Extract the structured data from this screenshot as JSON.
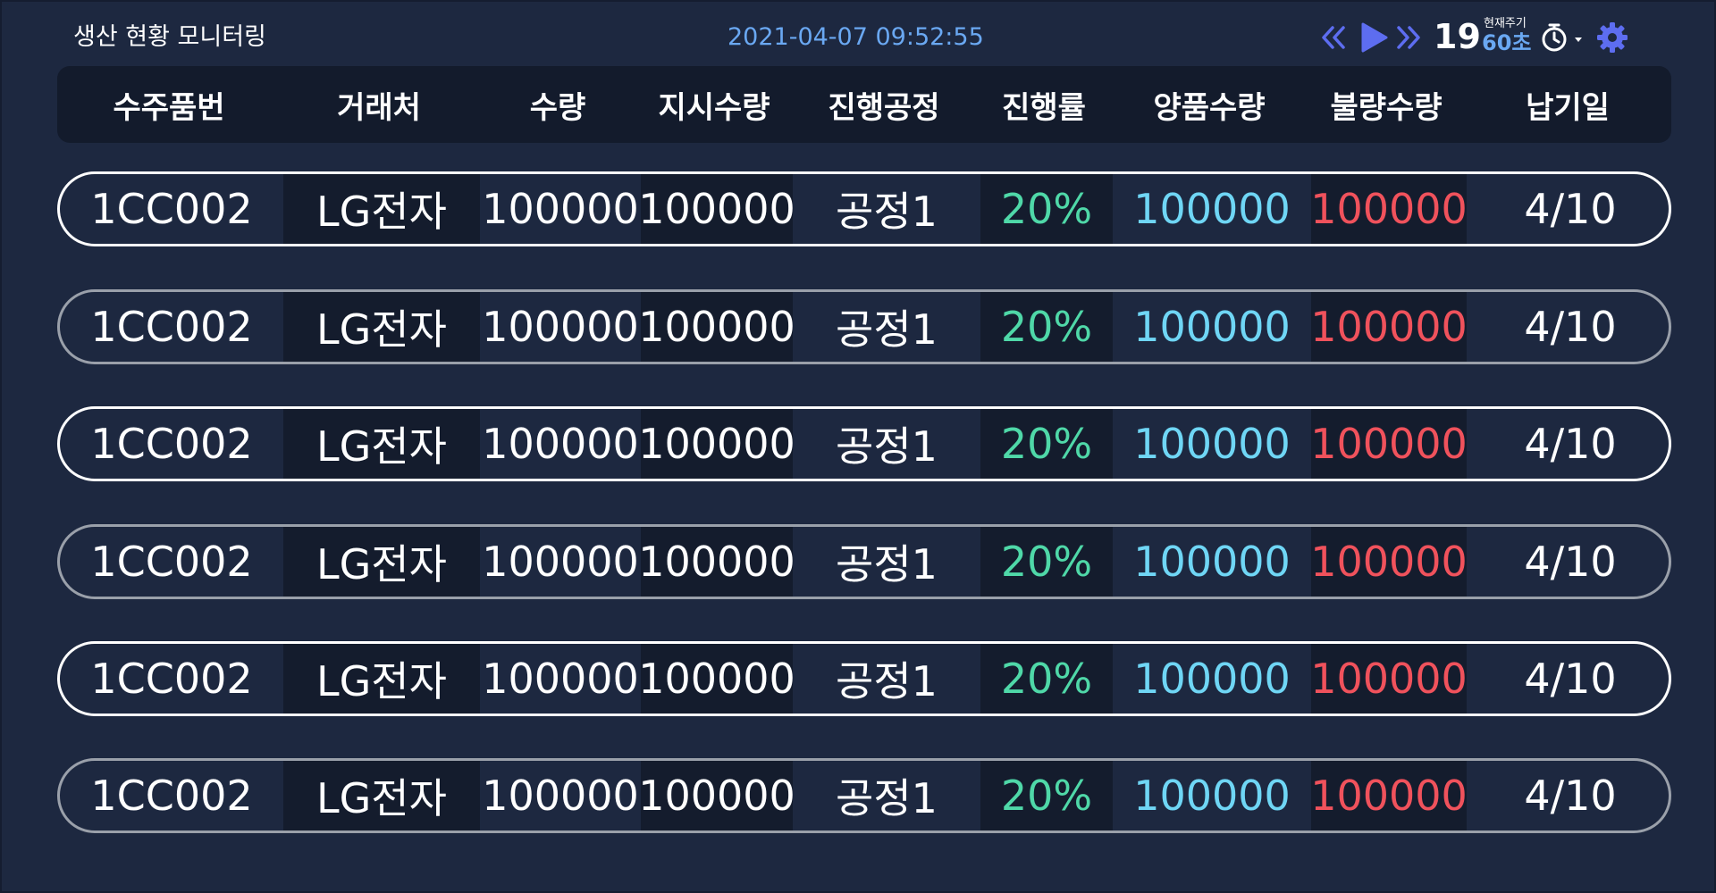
{
  "header": {
    "title": "생산 현황 모니터링",
    "datetime": "2021-04-07 09:52:55",
    "count": "19",
    "cycle_label": "현재주기",
    "cycle_value": "60초",
    "icons": [
      "double-chevron-left-icon",
      "play-icon",
      "double-chevron-right-icon",
      "timer-icon",
      "gear-icon"
    ],
    "colors": {
      "accent": "#6aa8f2",
      "play": "#5d6df0"
    }
  },
  "table": {
    "columns": [
      "수주품번",
      "거래처",
      "수량",
      "지시수량",
      "진행공정",
      "진행률",
      "양품수량",
      "불량수량",
      "납기일"
    ],
    "rows": [
      {
        "order_no": "1CC002",
        "client": "LG전자",
        "qty": "100000",
        "instr_qty": "100000",
        "process": "공정1",
        "progress": "20%",
        "good_qty": "100000",
        "defect_qty": "100000",
        "due_date": "4/10"
      },
      {
        "order_no": "1CC002",
        "client": "LG전자",
        "qty": "100000",
        "instr_qty": "100000",
        "process": "공정1",
        "progress": "20%",
        "good_qty": "100000",
        "defect_qty": "100000",
        "due_date": "4/10"
      },
      {
        "order_no": "1CC002",
        "client": "LG전자",
        "qty": "100000",
        "instr_qty": "100000",
        "process": "공정1",
        "progress": "20%",
        "good_qty": "100000",
        "defect_qty": "100000",
        "due_date": "4/10"
      },
      {
        "order_no": "1CC002",
        "client": "LG전자",
        "qty": "100000",
        "instr_qty": "100000",
        "process": "공정1",
        "progress": "20%",
        "good_qty": "100000",
        "defect_qty": "100000",
        "due_date": "4/10"
      },
      {
        "order_no": "1CC002",
        "client": "LG전자",
        "qty": "100000",
        "instr_qty": "100000",
        "process": "공정1",
        "progress": "20%",
        "good_qty": "100000",
        "defect_qty": "100000",
        "due_date": "4/10"
      },
      {
        "order_no": "1CC002",
        "client": "LG전자",
        "qty": "100000",
        "instr_qty": "100000",
        "process": "공정1",
        "progress": "20%",
        "good_qty": "100000",
        "defect_qty": "100000",
        "due_date": "4/10"
      }
    ],
    "colors": {
      "progress": "#4fd8a8",
      "good": "#6fd6f5",
      "defect": "#f0525c"
    }
  }
}
